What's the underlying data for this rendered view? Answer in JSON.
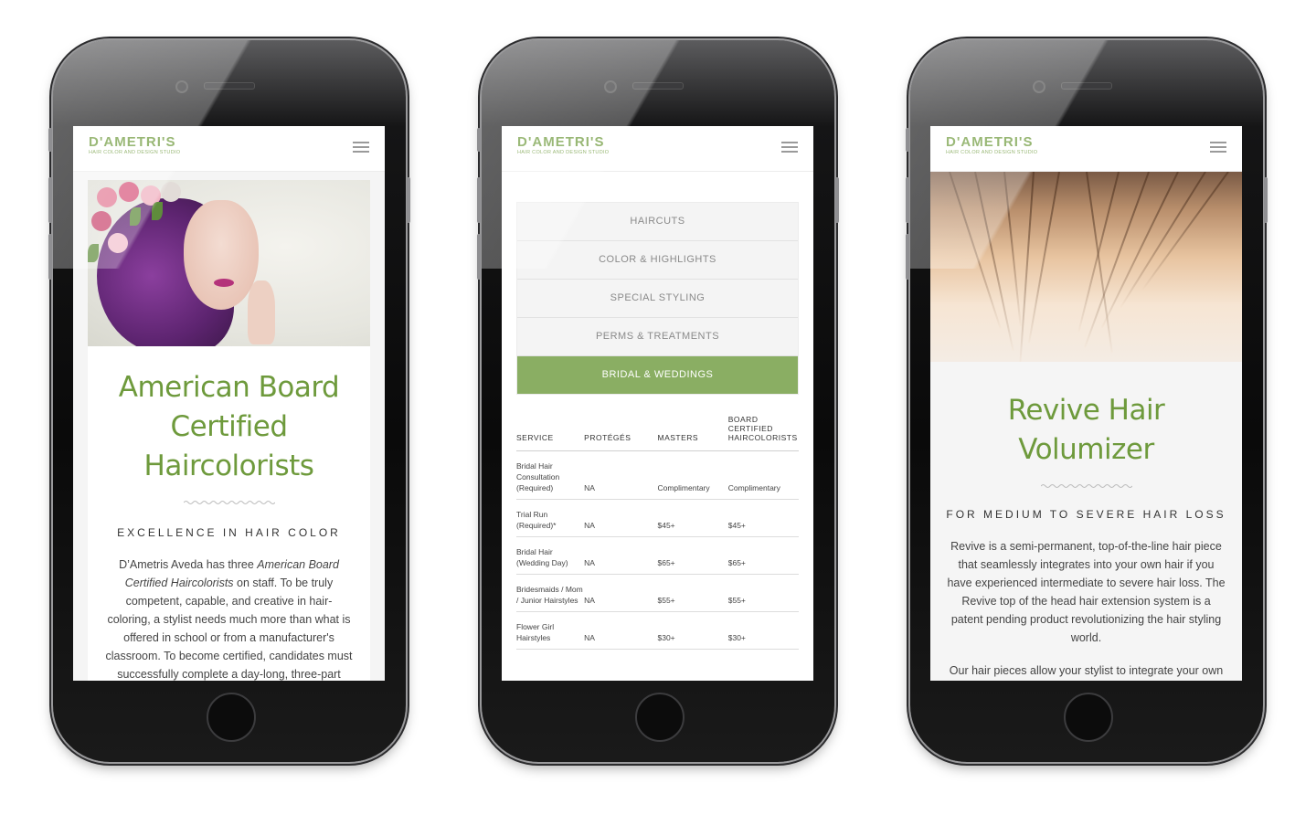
{
  "brand": {
    "name": "D'AMETRI'S",
    "tagline": "HAIR COLOR AND DESIGN STUDIO",
    "accent": "#6e9a3c"
  },
  "phone1": {
    "headline_lines": [
      "American Board",
      "Certified",
      "Haircolorists"
    ],
    "kicker": "EXCELLENCE IN HAIR COLOR",
    "body_parts": [
      "D’Ametris Aveda has three ",
      "American Board Certified Haircolorists",
      " on staff. To be truly competent, capable, and creative in hair-coloring, a stylist needs much more than what is offered in school or from a manufacturer's classroom. To become certified, candidates must successfully complete a day-long, three-part examination that"
    ]
  },
  "phone2": {
    "categories": [
      {
        "label": "HAIRCUTS",
        "active": false
      },
      {
        "label": "COLOR & HIGHLIGHTS",
        "active": false
      },
      {
        "label": "SPECIAL STYLING",
        "active": false
      },
      {
        "label": "PERMS & TREATMENTS",
        "active": false
      },
      {
        "label": "BRIDAL & WEDDINGS",
        "active": true
      }
    ],
    "active_color": "#8aae63",
    "table": {
      "headers": [
        "SERVICE",
        "PROTÉGÉS",
        "MASTERS",
        "BOARD CERTIFIED HAIRCOLORISTS"
      ],
      "rows": [
        [
          "Bridal Hair Consultation (Required)",
          "NA",
          "Complimentary",
          "Complimentary"
        ],
        [
          "Trial Run (Required)*",
          "NA",
          "$45+",
          "$45+"
        ],
        [
          "Bridal Hair (Wedding Day)",
          "NA",
          "$65+",
          "$65+"
        ],
        [
          "Bridesmaids / Mom / Junior Hairstyles",
          "NA",
          "$55+",
          "$55+"
        ],
        [
          "Flower Girl Hairstyles",
          "NA",
          "$30+",
          "$30+"
        ]
      ]
    }
  },
  "phone3": {
    "headline_lines": [
      "Revive Hair",
      "Volumizer"
    ],
    "kicker": "FOR MEDIUM TO SEVERE HAIR LOSS",
    "paragraphs": [
      "Revive is a semi-permanent, top-of-the-line hair piece that seamlessly integrates into your own hair if you have experienced intermediate to severe hair loss. The Revive top of the head hair extension system is a patent pending product revolutionizing the hair styling world.",
      "Our hair pieces allow your stylist to integrate your own hair with our hair pieces to ensure that your hair has"
    ]
  }
}
